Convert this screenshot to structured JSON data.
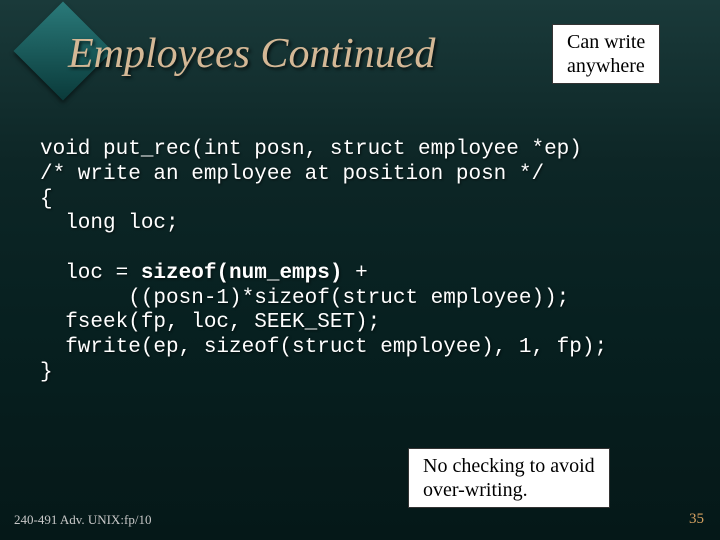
{
  "title": "Employees Continued",
  "note1_l1": "Can write",
  "note1_l2": "anywhere",
  "note2_l1": "No checking to avoid",
  "note2_l2": "over-writing.",
  "code": {
    "l1": "void put_rec(int posn, struct employee *ep)",
    "l2": "/* write an employee at position posn */",
    "l3": "{",
    "l4": "  long loc;",
    "l5a": "  loc = ",
    "l5b": "sizeof(num_emps)",
    "l5c": " +",
    "l6": "       ((posn-1)*sizeof(struct employee));",
    "l7": "  fseek(fp, loc, SEEK_SET);",
    "l8": "  fwrite(ep, sizeof(struct employee), 1, fp);",
    "l9": "}"
  },
  "footer": "240-491 Adv. UNIX:fp/10",
  "page": "35"
}
